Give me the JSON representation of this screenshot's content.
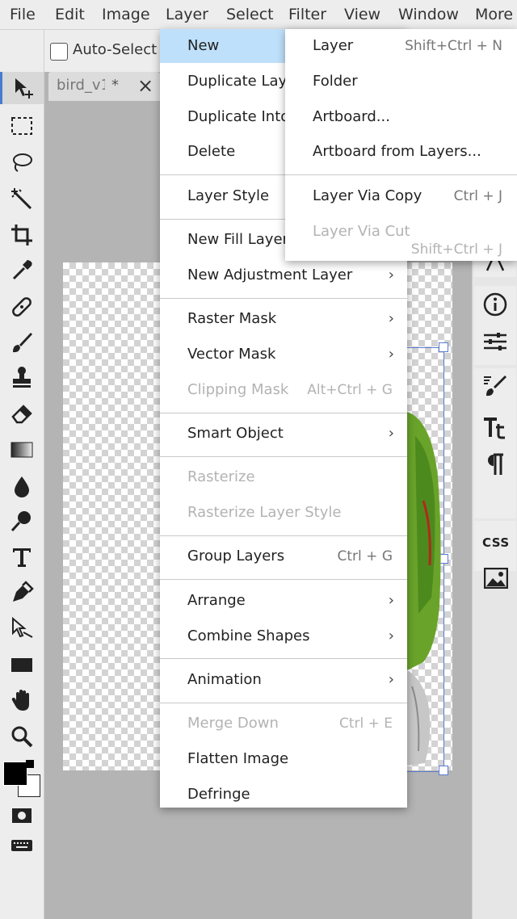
{
  "menubar": [
    "File",
    "Edit",
    "Image",
    "Layer",
    "Select",
    "Filter",
    "View",
    "Window",
    "More"
  ],
  "options": {
    "auto_select_label": "Auto-Select"
  },
  "tab": {
    "title": "bird_v1",
    "modified": "*",
    "close": "×"
  },
  "layer_menu": [
    {
      "label": "New",
      "highlight": true
    },
    {
      "label": "Duplicate Layer"
    },
    {
      "label": "Duplicate Into"
    },
    {
      "label": "Delete"
    },
    {
      "sep": true
    },
    {
      "label": "Layer Style"
    },
    {
      "sep": true
    },
    {
      "label": "New Fill Layer"
    },
    {
      "label": "New Adjustment Layer",
      "arrow": "›"
    },
    {
      "sep": true
    },
    {
      "label": "Raster Mask",
      "arrow": "›"
    },
    {
      "label": "Vector Mask",
      "arrow": "›"
    },
    {
      "label": "Clipping Mask",
      "shortcut": "Alt+Ctrl + G",
      "disabled": true
    },
    {
      "sep": true
    },
    {
      "label": "Smart Object",
      "arrow": "›"
    },
    {
      "sep": true
    },
    {
      "label": "Rasterize",
      "disabled": true
    },
    {
      "label": "Rasterize Layer Style",
      "disabled": true
    },
    {
      "sep": true
    },
    {
      "label": "Group Layers",
      "shortcut": "Ctrl + G"
    },
    {
      "sep": true
    },
    {
      "label": "Arrange",
      "arrow": "›"
    },
    {
      "label": "Combine Shapes",
      "arrow": "›"
    },
    {
      "sep": true
    },
    {
      "label": "Animation",
      "arrow": "›"
    },
    {
      "sep": true
    },
    {
      "label": "Merge Down",
      "shortcut": "Ctrl + E",
      "disabled": true
    },
    {
      "label": "Flatten Image"
    },
    {
      "label": "Defringe"
    }
  ],
  "new_submenu": [
    {
      "label": "Layer",
      "shortcut": "Shift+Ctrl + N"
    },
    {
      "label": "Folder"
    },
    {
      "label": "Artboard..."
    },
    {
      "label": "Artboard from Layers..."
    },
    {
      "sep": true
    },
    {
      "label": "Layer Via Copy",
      "shortcut": "Ctrl + J"
    },
    {
      "label": "Layer Via Cut",
      "shortcut": "Shift+Ctrl + J",
      "disabled": true
    }
  ],
  "right_panel": {
    "css_label": "CSS"
  },
  "colors": {
    "highlight": "#bfe0fb",
    "accent": "#4a7bd0",
    "leaf_green": "#6aa32a"
  }
}
